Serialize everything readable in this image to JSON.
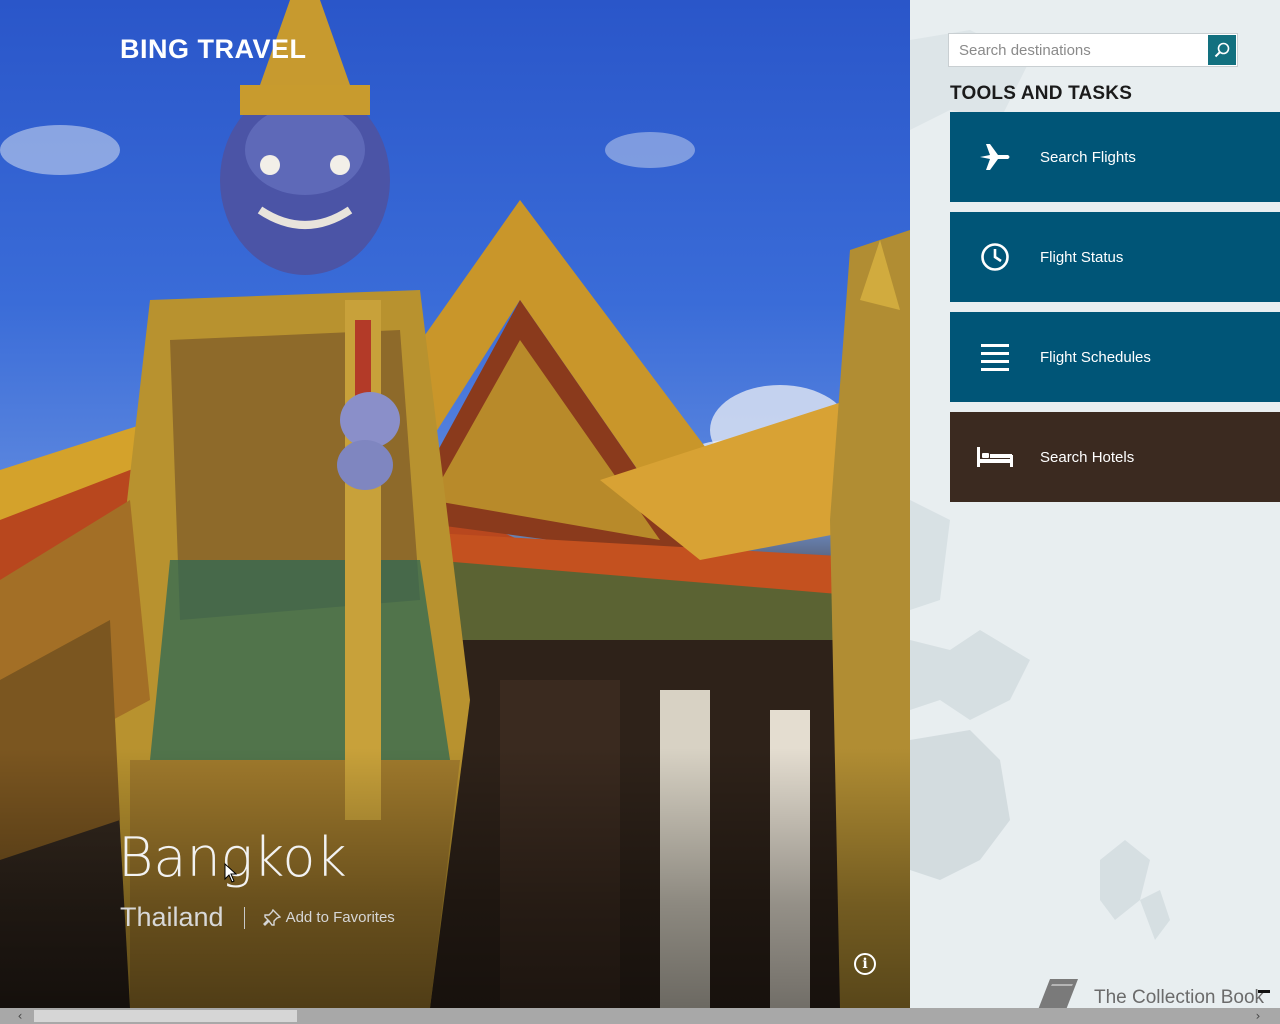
{
  "app": {
    "title": "BING TRAVEL"
  },
  "destination": {
    "city": "Bangkok",
    "country": "Thailand",
    "favorite_label": "Add to Favorites",
    "info_icon": "info-icon"
  },
  "search": {
    "placeholder": "Search destinations",
    "value": "",
    "icon": "search-icon"
  },
  "tools": {
    "heading": "TOOLS AND TASKS",
    "items": [
      {
        "label": "Search Flights",
        "icon": "airplane-icon",
        "color": "#005577"
      },
      {
        "label": "Flight Status",
        "icon": "clock-icon",
        "color": "#005577"
      },
      {
        "label": "Flight Schedules",
        "icon": "list-icon",
        "color": "#005577"
      },
      {
        "label": "Search Hotels",
        "icon": "bed-icon",
        "color": "#3b2a20"
      }
    ]
  },
  "collection": {
    "label": "The Collection Book",
    "icon": "book-icon"
  },
  "colors": {
    "accent": "#12707f",
    "tile_blue": "#005577",
    "tile_brown": "#3b2a20",
    "panel_bg": "#e8eef0"
  }
}
